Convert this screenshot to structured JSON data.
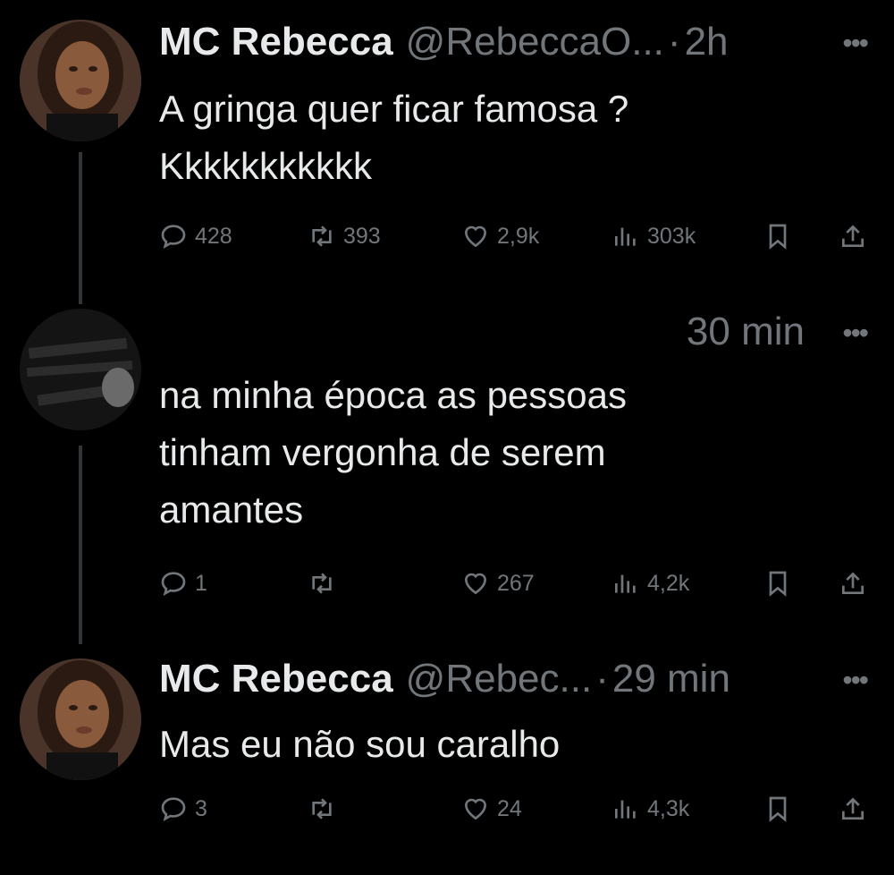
{
  "tweets": [
    {
      "name": "MC Rebecca",
      "handle": "@RebeccaO...",
      "time": "2h",
      "text": "A gringa quer ficar famosa ?\nKkkkkkkkkkk",
      "stats": {
        "replies": "428",
        "retweets": "393",
        "likes": "2,9k",
        "views": "303k"
      }
    },
    {
      "name": "",
      "handle": "",
      "time": "30 min",
      "text": "na minha época as pessoas\ntinham vergonha de serem\namantes",
      "stats": {
        "replies": "1",
        "retweets": "",
        "likes": "267",
        "views": "4,2k"
      }
    },
    {
      "name": "MC Rebecca",
      "handle": "@Rebec...",
      "time": "29 min",
      "text": "Mas eu não sou caralho",
      "stats": {
        "replies": "3",
        "retweets": "",
        "likes": "24",
        "views": "4,3k"
      }
    }
  ],
  "colors": {
    "background": "#000000",
    "text": "#e7e9ea",
    "secondary": "#71767b"
  },
  "icons": [
    "reply-icon",
    "retweet-icon",
    "like-icon",
    "views-icon",
    "bookmark-icon",
    "share-icon",
    "more-icon"
  ]
}
